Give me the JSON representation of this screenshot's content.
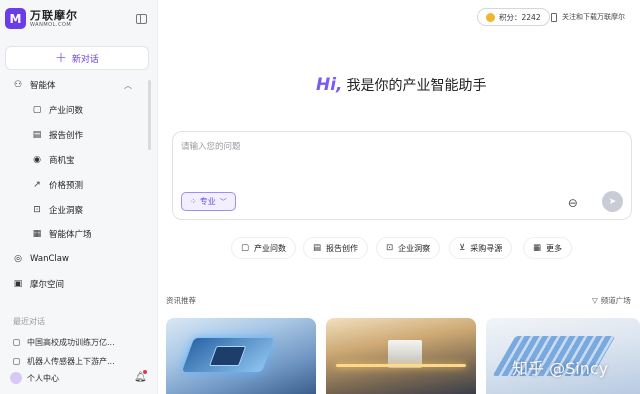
{
  "brand": {
    "cn": "万联摩尔",
    "en": "WANMOL.COM",
    "mark": "M"
  },
  "sidebar": {
    "new_chat_label": "新对话",
    "agent_group": {
      "label": "智能体",
      "expanded": true
    },
    "agent_items": [
      {
        "label": "产业问数",
        "icon": "chat-icon"
      },
      {
        "label": "报告创作",
        "icon": "report-icon"
      },
      {
        "label": "商机宝",
        "icon": "location-icon"
      },
      {
        "label": "价格预测",
        "icon": "trend-icon"
      },
      {
        "label": "企业洞察",
        "icon": "insight-icon"
      },
      {
        "label": "智能体广场",
        "icon": "grid-icon"
      }
    ],
    "top_items": [
      {
        "label": "WanClaw",
        "icon": "claw-icon"
      },
      {
        "label": "摩尔空间",
        "icon": "space-icon"
      }
    ],
    "recent_header": "最近对话",
    "recent_items": [
      "中国高校成功训练万亿...",
      "机器人传感器上下游产..."
    ],
    "user_label": "个人中心"
  },
  "header": {
    "points_label": "积分：",
    "points_value": "2242",
    "download_label": "关注和下载万联摩尔"
  },
  "main": {
    "greeting_hi": "Hi,",
    "greeting_text": "我是你的产业智能助手",
    "input_placeholder": "请输入您的问题",
    "mode_label": "专业",
    "quick_actions": [
      {
        "label": "产业问数",
        "icon": "chat-icon"
      },
      {
        "label": "报告创作",
        "icon": "report-icon"
      },
      {
        "label": "企业洞察",
        "icon": "insight-icon"
      },
      {
        "label": "采购寻源",
        "icon": "cart-icon"
      },
      {
        "label": "更多",
        "icon": "grid-icon"
      }
    ],
    "news_label": "资讯推荐",
    "channel_label": "频道广场",
    "watermark": "知乎 @Sincy"
  },
  "colors": {
    "accent": "#6a3de8",
    "hi": "#7b5cf0",
    "coin": "#f2b52c"
  }
}
